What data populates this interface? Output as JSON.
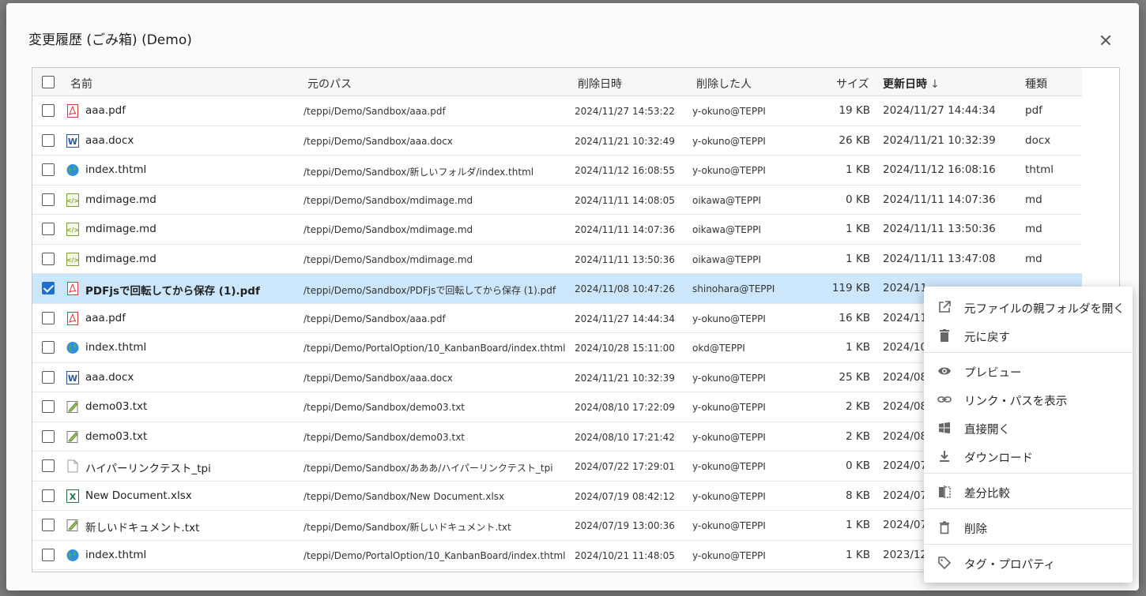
{
  "dialog": {
    "title": "変更履歴 (ごみ箱) (Demo)"
  },
  "columns": {
    "name": "名前",
    "path": "元のパス",
    "deleted_at": "削除日時",
    "deleted_by": "削除した人",
    "size": "サイズ",
    "updated_at": "更新日時",
    "type": "種類"
  },
  "rows": [
    {
      "name": "aaa.pdf",
      "icon": "pdf-icon",
      "path": "/teppi/Demo/Sandbox/aaa.pdf",
      "deleted_at": "2024/11/27 14:53:22",
      "deleted_by": "y-okuno@TEPPI",
      "size": "19 KB",
      "updated_at": "2024/11/27 14:44:34",
      "type": "pdf",
      "checked": false
    },
    {
      "name": "aaa.docx",
      "icon": "word-icon",
      "path": "/teppi/Demo/Sandbox/aaa.docx",
      "deleted_at": "2024/11/21 10:32:49",
      "deleted_by": "y-okuno@TEPPI",
      "size": "26 KB",
      "updated_at": "2024/11/21 10:32:39",
      "type": "docx",
      "checked": false
    },
    {
      "name": "index.thtml",
      "icon": "globe-icon",
      "path": "/teppi/Demo/Sandbox/新しいフォルダ/index.thtml",
      "deleted_at": "2024/11/12 16:08:55",
      "deleted_by": "y-okuno@TEPPI",
      "size": "1 KB",
      "updated_at": "2024/11/12 16:08:16",
      "type": "thtml",
      "checked": false
    },
    {
      "name": "mdimage.md",
      "icon": "code-icon",
      "path": "/teppi/Demo/Sandbox/mdimage.md",
      "deleted_at": "2024/11/11 14:08:05",
      "deleted_by": "oikawa@TEPPI",
      "size": "0 KB",
      "updated_at": "2024/11/11 14:07:36",
      "type": "md",
      "checked": false
    },
    {
      "name": "mdimage.md",
      "icon": "code-icon",
      "path": "/teppi/Demo/Sandbox/mdimage.md",
      "deleted_at": "2024/11/11 14:07:36",
      "deleted_by": "oikawa@TEPPI",
      "size": "1 KB",
      "updated_at": "2024/11/11 13:50:36",
      "type": "md",
      "checked": false
    },
    {
      "name": "mdimage.md",
      "icon": "code-icon",
      "path": "/teppi/Demo/Sandbox/mdimage.md",
      "deleted_at": "2024/11/11 13:50:36",
      "deleted_by": "oikawa@TEPPI",
      "size": "1 KB",
      "updated_at": "2024/11/11 13:47:08",
      "type": "md",
      "checked": false
    },
    {
      "name": "PDFjsで回転してから保存 (1).pdf",
      "icon": "pdf-icon",
      "path": "/teppi/Demo/Sandbox/PDFjsで回転してから保存 (1).pdf",
      "deleted_at": "2024/11/08 10:47:26",
      "deleted_by": "shinohara@TEPPI",
      "size": "119 KB",
      "updated_at": "2024/11,",
      "type": "",
      "checked": true
    },
    {
      "name": "aaa.pdf",
      "icon": "pdf-icon",
      "path": "/teppi/Demo/Sandbox/aaa.pdf",
      "deleted_at": "2024/11/27 14:44:34",
      "deleted_by": "y-okuno@TEPPI",
      "size": "16 KB",
      "updated_at": "2024/11,",
      "type": "",
      "checked": false
    },
    {
      "name": "index.thtml",
      "icon": "globe-icon",
      "path": "/teppi/Demo/PortalOption/10_KanbanBoard/index.thtml",
      "deleted_at": "2024/10/28 15:11:00",
      "deleted_by": "okd@TEPPI",
      "size": "1 KB",
      "updated_at": "2024/10,",
      "type": "",
      "checked": false
    },
    {
      "name": "aaa.docx",
      "icon": "word-icon",
      "path": "/teppi/Demo/Sandbox/aaa.docx",
      "deleted_at": "2024/11/21 10:32:39",
      "deleted_by": "y-okuno@TEPPI",
      "size": "25 KB",
      "updated_at": "2024/08,",
      "type": "",
      "checked": false
    },
    {
      "name": "demo03.txt",
      "icon": "text-edit-icon",
      "path": "/teppi/Demo/Sandbox/demo03.txt",
      "deleted_at": "2024/08/10 17:22:09",
      "deleted_by": "y-okuno@TEPPI",
      "size": "2 KB",
      "updated_at": "2024/08,",
      "type": "",
      "checked": false
    },
    {
      "name": "demo03.txt",
      "icon": "text-edit-icon",
      "path": "/teppi/Demo/Sandbox/demo03.txt",
      "deleted_at": "2024/08/10 17:21:42",
      "deleted_by": "y-okuno@TEPPI",
      "size": "2 KB",
      "updated_at": "2024/08,",
      "type": "",
      "checked": false
    },
    {
      "name": "ハイパーリンクテスト_tpi",
      "icon": "blank-file-icon",
      "path": "/teppi/Demo/Sandbox/あああ/ハイパーリンクテスト_tpi",
      "deleted_at": "2024/07/22 17:29:01",
      "deleted_by": "y-okuno@TEPPI",
      "size": "0 KB",
      "updated_at": "2024/07,",
      "type": "",
      "checked": false
    },
    {
      "name": "New Document.xlsx",
      "icon": "excel-icon",
      "path": "/teppi/Demo/Sandbox/New Document.xlsx",
      "deleted_at": "2024/07/19 08:42:12",
      "deleted_by": "y-okuno@TEPPI",
      "size": "8 KB",
      "updated_at": "2024/07,",
      "type": "",
      "checked": false
    },
    {
      "name": "新しいドキュメント.txt",
      "icon": "text-edit-icon",
      "path": "/teppi/Demo/Sandbox/新しいドキュメント.txt",
      "deleted_at": "2024/07/19 13:00:36",
      "deleted_by": "y-okuno@TEPPI",
      "size": "1 KB",
      "updated_at": "2024/07,",
      "type": "",
      "checked": false
    },
    {
      "name": "index.thtml",
      "icon": "globe-icon",
      "path": "/teppi/Demo/PortalOption/10_KanbanBoard/index.thtml",
      "deleted_at": "2024/10/21 11:48:05",
      "deleted_by": "y-okuno@TEPPI",
      "size": "1 KB",
      "updated_at": "2023/12,",
      "type": "",
      "checked": false
    }
  ],
  "context_menu": [
    {
      "label": "元ファイルの親フォルダを開く",
      "icon": "open-external-icon"
    },
    {
      "label": "元に戻す",
      "icon": "restore-icon"
    },
    {
      "label": "プレビュー",
      "icon": "eye-icon"
    },
    {
      "label": "リンク・パスを表示",
      "icon": "link-icon"
    },
    {
      "label": "直接開く",
      "icon": "windows-icon"
    },
    {
      "label": "ダウンロード",
      "icon": "download-icon"
    },
    {
      "label": "差分比較",
      "icon": "compare-icon"
    },
    {
      "label": "削除",
      "icon": "trash-icon"
    },
    {
      "label": "タグ・プロパティ",
      "icon": "tag-icon"
    }
  ],
  "colors": {
    "selected_row": "#cce6fb",
    "checkbox_accent": "#1d6fd0"
  }
}
